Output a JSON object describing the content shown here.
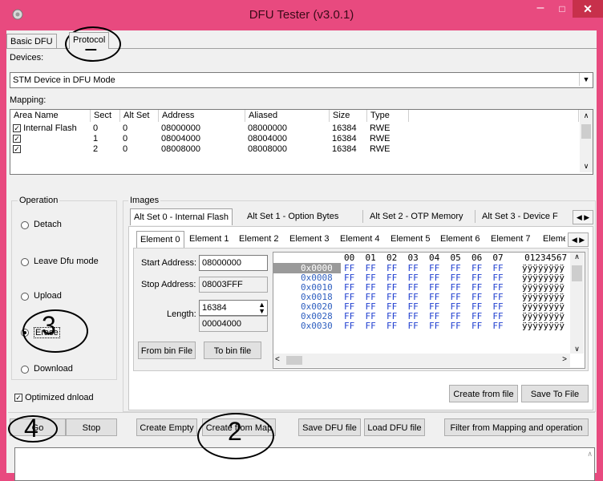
{
  "window": {
    "title": "DFU Tester (v3.0.1)",
    "minimize": "–",
    "maximize": "□",
    "close": "✕"
  },
  "tabs": {
    "basic": "Basic DFU",
    "protocol": "Protocol"
  },
  "devices": {
    "label": "Devices:",
    "selected": "STM Device in DFU Mode"
  },
  "mapping": {
    "label": "Mapping:",
    "columns": [
      "Area Name",
      "Sect",
      "Alt Set",
      "Address",
      "Aliased",
      "Size",
      "Type"
    ],
    "rows": [
      {
        "name": "Internal Flash",
        "sect": "0",
        "alt": "0",
        "address": "08000000",
        "aliased": "08000000",
        "size": "16384",
        "type": "RWE"
      },
      {
        "name": "",
        "sect": "1",
        "alt": "0",
        "address": "08004000",
        "aliased": "08004000",
        "size": "16384",
        "type": "RWE"
      },
      {
        "name": "",
        "sect": "2",
        "alt": "0",
        "address": "08008000",
        "aliased": "08008000",
        "size": "16384",
        "type": "RWE"
      }
    ]
  },
  "operation": {
    "title": "Operation",
    "options": [
      "Detach",
      "Leave Dfu mode",
      "Upload",
      "Erase",
      "Download"
    ],
    "selected": "Erase"
  },
  "optimized": {
    "label": "Optimized dnload",
    "checked": true
  },
  "images": {
    "title": "Images",
    "alt_tabs": [
      "Alt Set 0 - Internal Flash",
      "Alt Set 1 - Option Bytes",
      "Alt Set 2 - OTP Memory",
      "Alt Set 3 - Device F"
    ],
    "element_tabs": [
      "Element 0",
      "Element 1",
      "Element 2",
      "Element 3",
      "Element 4",
      "Element 5",
      "Element 6",
      "Element 7",
      "Eleme"
    ],
    "start_label": "Start Address:",
    "start_value": "08000000",
    "stop_label": "Stop Address:",
    "stop_value": "08003FFF",
    "length_label": "Length:",
    "length_value": "16384",
    "length_hex": "00004000",
    "from_bin": "From bin File",
    "to_bin": "To bin file",
    "create_from_file": "Create from file",
    "save_to_file": "Save To File"
  },
  "hex": {
    "header": "00  01  02  03  04  05  06  07    01234567",
    "rows": [
      {
        "addr": "0x0000",
        "bytes": "FF  FF  FF  FF  FF  FF  FF  FF",
        "ascii": "ÿÿÿÿÿÿÿÿ"
      },
      {
        "addr": "0x0008",
        "bytes": "FF  FF  FF  FF  FF  FF  FF  FF",
        "ascii": "ÿÿÿÿÿÿÿÿ"
      },
      {
        "addr": "0x0010",
        "bytes": "FF  FF  FF  FF  FF  FF  FF  FF",
        "ascii": "ÿÿÿÿÿÿÿÿ"
      },
      {
        "addr": "0x0018",
        "bytes": "FF  FF  FF  FF  FF  FF  FF  FF",
        "ascii": "ÿÿÿÿÿÿÿÿ"
      },
      {
        "addr": "0x0020",
        "bytes": "FF  FF  FF  FF  FF  FF  FF  FF",
        "ascii": "ÿÿÿÿÿÿÿÿ"
      },
      {
        "addr": "0x0028",
        "bytes": "FF  FF  FF  FF  FF  FF  FF  FF",
        "ascii": "ÿÿÿÿÿÿÿÿ"
      },
      {
        "addr": "0x0030",
        "bytes": "FF  FF  FF  FF  FF  FF  FF  FF",
        "ascii": "ÿÿÿÿÿÿÿÿ"
      }
    ]
  },
  "buttons": {
    "go": "Go",
    "stop": "Stop",
    "create_empty": "Create Empty",
    "create_from_map": "Create from Map",
    "save_dfu": "Save DFU file",
    "load_dfu": "Load DFU file",
    "filter": "Filter from Mapping and operation"
  },
  "annotations": [
    "1",
    "2",
    "3",
    "4"
  ],
  "colors": {
    "titlebar": "#e84a7f",
    "close": "#c7304b",
    "hex_blue": "#1f3fd0",
    "addr_blue": "#3060c0"
  }
}
